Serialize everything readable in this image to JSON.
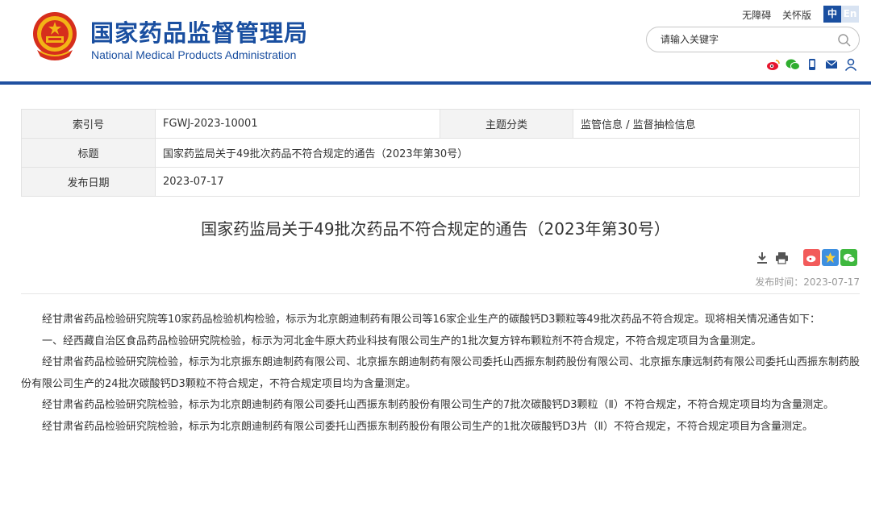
{
  "header": {
    "site_title_cn": "国家药品监督管理局",
    "site_title_en": "National Medical Products Administration",
    "accessibility_label": "无障碍",
    "care_label": "关怀版",
    "lang_zh": "中",
    "lang_en": "En",
    "search_placeholder": "请输入关键字",
    "social_icons": [
      "weibo-icon",
      "wechat-icon",
      "mobile-icon",
      "mail-icon",
      "user-icon"
    ],
    "brand_color": "#1a4fa0"
  },
  "info": {
    "index_label": "索引号",
    "index_value": "FGWJ-2023-10001",
    "category_label": "主题分类",
    "category_value": "监管信息 / 监督抽检信息",
    "title_label": "标题",
    "title_value": "国家药监局关于49批次药品不符合规定的通告（2023年第30号）",
    "date_label": "发布日期",
    "date_value": "2023-07-17"
  },
  "article": {
    "title": "国家药监局关于49批次药品不符合规定的通告（2023年第30号）",
    "tool_icons": [
      "download-icon",
      "print-icon",
      "weibo-share-icon",
      "qzone-share-icon",
      "wechat-share-icon"
    ],
    "pub_time": "发布时间：2023-07-17",
    "paragraphs": [
      "经甘肃省药品检验研究院等10家药品检验机构检验，标示为北京朗迪制药有限公司等16家企业生产的碳酸钙D3颗粒等49批次药品不符合规定。现将相关情况通告如下：",
      "一、经西藏自治区食品药品检验研究院检验，标示为河北金牛原大药业科技有限公司生产的1批次复方锌布颗粒剂不符合规定，不符合规定项目为含量测定。",
      "经甘肃省药品检验研究院检验，标示为北京振东朗迪制药有限公司、北京振东朗迪制药有限公司委托山西振东制药股份有限公司、北京振东康远制药有限公司委托山西振东制药股份有限公司生产的24批次碳酸钙D3颗粒不符合规定，不符合规定项目均为含量测定。",
      "经甘肃省药品检验研究院检验，标示为北京朗迪制药有限公司委托山西振东制药股份有限公司生产的7批次碳酸钙D3颗粒（Ⅱ）不符合规定，不符合规定项目均为含量测定。",
      "经甘肃省药品检验研究院检验，标示为北京朗迪制药有限公司委托山西振东制药股份有限公司生产的1批次碳酸钙D3片（Ⅱ）不符合规定，不符合规定项目为含量测定。"
    ]
  }
}
